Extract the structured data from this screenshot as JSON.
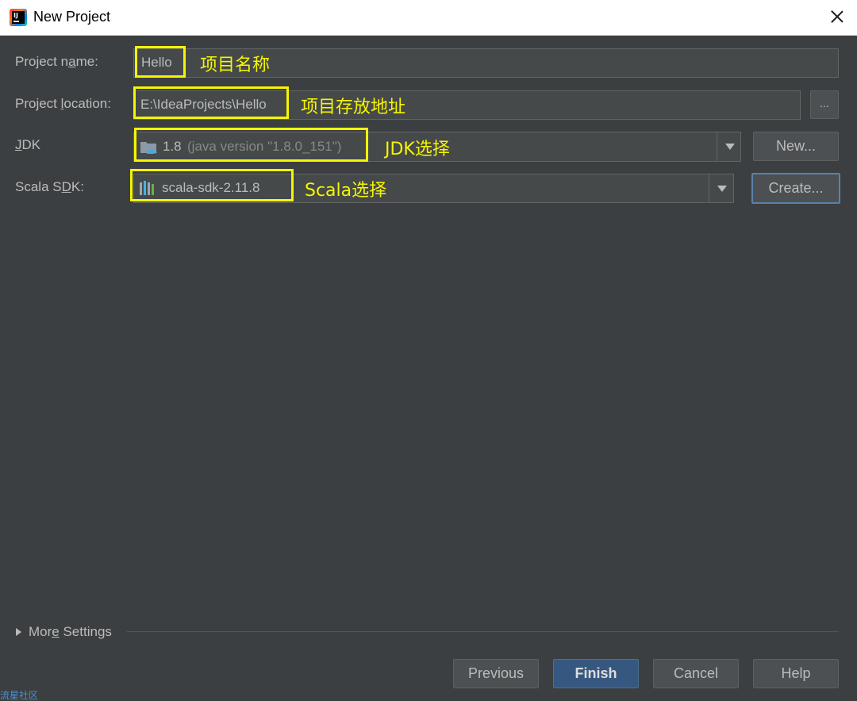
{
  "window": {
    "title": "New Project",
    "app_icon_letters": "IJ"
  },
  "form": {
    "project_name": {
      "label_pre": "Project n",
      "label_mnemonic": "a",
      "label_post": "me:",
      "value": "Hello",
      "annotation": "项目名称"
    },
    "project_location": {
      "label_pre": "Project ",
      "label_mnemonic": "l",
      "label_post": "ocation:",
      "value": "E:\\IdeaProjects\\Hello",
      "annotation": "项目存放地址",
      "browse_label": "..."
    },
    "jdk": {
      "label_pre": "",
      "label_mnemonic": "J",
      "label_post": "DK",
      "version": "1.8",
      "detail": "(java version \"1.8.0_151\")",
      "annotation": "JDK选择",
      "new_label": "New..."
    },
    "scala_sdk": {
      "label_pre": "Scala S",
      "label_mnemonic": "D",
      "label_post": "K:",
      "value": "scala-sdk-2.11.8",
      "annotation": "Scala选择",
      "create_label": "Create..."
    }
  },
  "more_settings": {
    "label_pre": "Mor",
    "label_mnemonic": "e",
    "label_post": " Settings"
  },
  "footer": {
    "previous_label": "Previous",
    "finish_label": "Finish",
    "cancel_label": "Cancel",
    "help_label": "Help"
  },
  "watermark": "流星社区",
  "colors": {
    "background": "#3c3f41",
    "highlight": "#f5f500",
    "primary_button": "#365880"
  }
}
